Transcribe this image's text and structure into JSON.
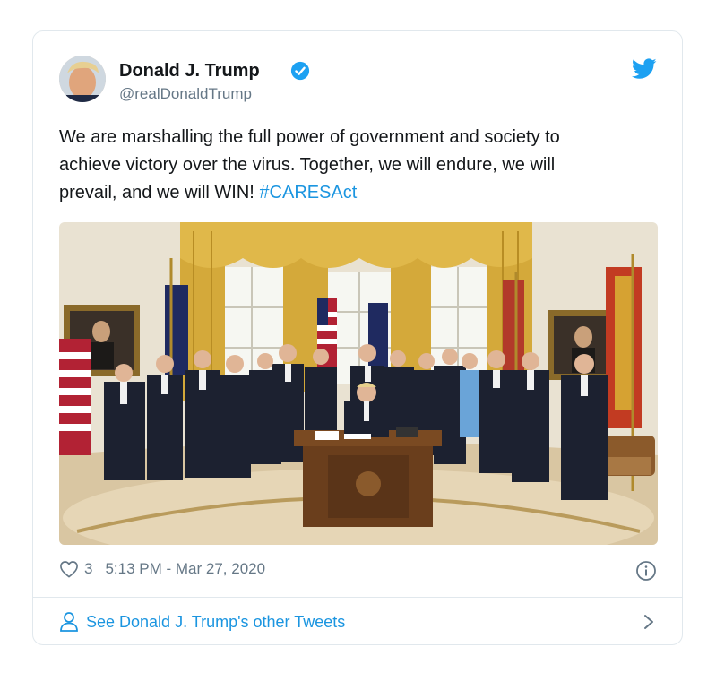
{
  "tweet": {
    "author_name": "Donald J. Trump",
    "handle": "@realDonaldTrump",
    "text_line1": "We are marshalling the full power of government and society to",
    "text_line2": "achieve victory over the virus. Together, we will endure, we will",
    "text_line3_plain": "prevail, and we will WIN! ",
    "hashtag": "#CARESAct",
    "likes": "3",
    "timestamp": "5:13 PM - Mar 27, 2020",
    "footer_link": "See Donald J. Trump's other Tweets"
  },
  "icons": {
    "verified": "verified-badge-icon",
    "brand": "twitter-bird-icon",
    "like": "heart-icon",
    "info": "info-icon",
    "profile": "person-icon",
    "chevron": "chevron-right-icon"
  },
  "colors": {
    "link": "#1b95e0",
    "text": "#14171a",
    "muted": "#657786",
    "border": "#e1e8ed"
  }
}
